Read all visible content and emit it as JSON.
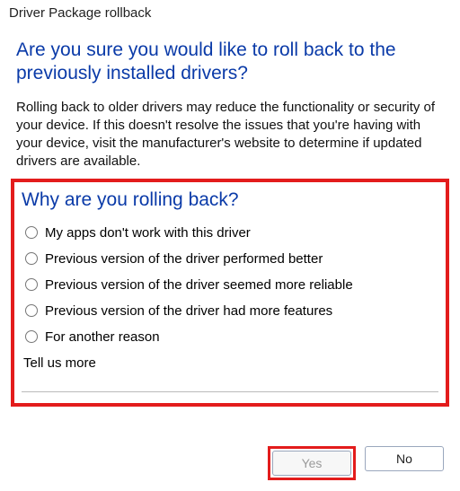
{
  "titlebar": "Driver Package rollback",
  "heading": "Are you sure you would like to roll back to the previously installed drivers?",
  "description": "Rolling back to older drivers may reduce the functionality or security of your device. If this doesn't resolve the issues that you're having with your device, visit the manufacturer's website to determine if updated drivers are available.",
  "survey": {
    "heading": "Why are you rolling back?",
    "options": [
      "My apps don't work with this driver",
      "Previous version of the driver performed better",
      "Previous version of the driver seemed more reliable",
      "Previous version of the driver had more features",
      "For another reason"
    ],
    "more_label": "Tell us more",
    "more_value": ""
  },
  "buttons": {
    "yes_label": "Yes",
    "no_label": "No"
  },
  "annotations": {
    "highlight_color": "#e31c1c",
    "highlighted_elements": [
      "survey-box",
      "yes-button"
    ]
  }
}
